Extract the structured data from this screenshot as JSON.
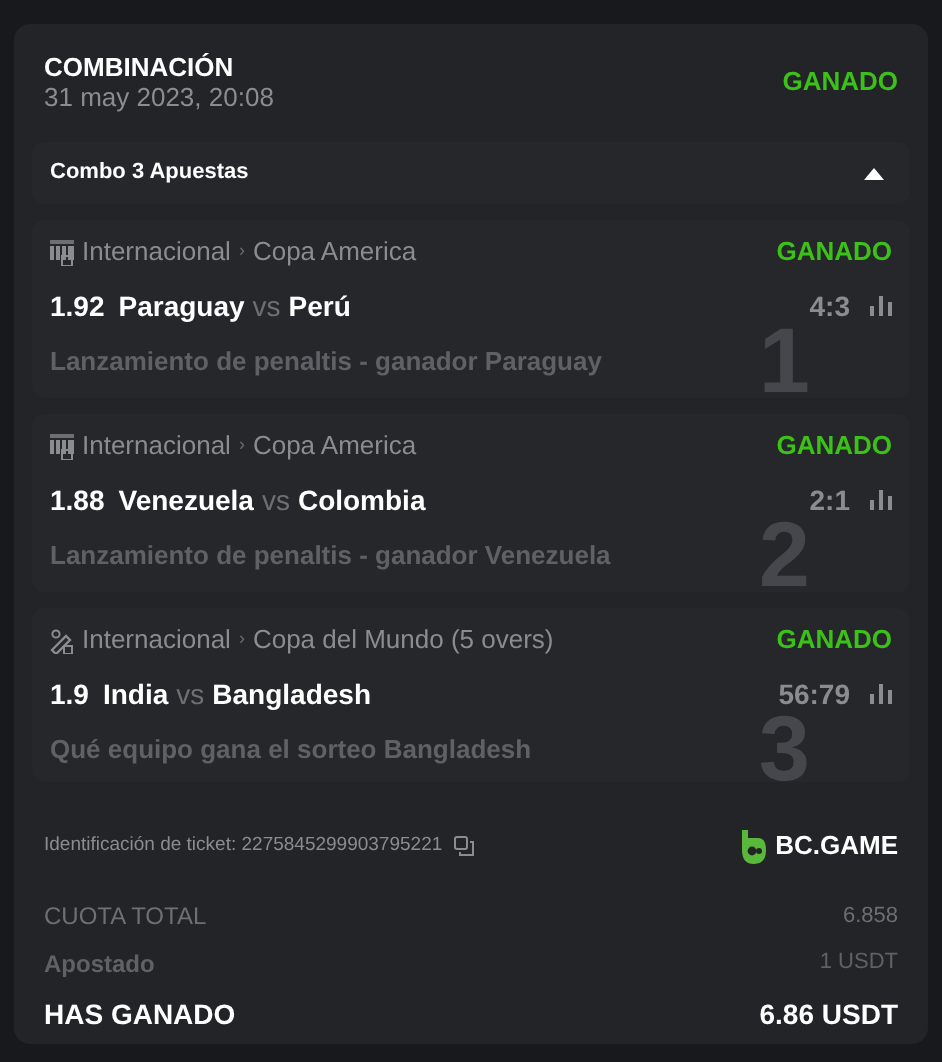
{
  "header": {
    "title": "COMBINACIÓN",
    "date": "31 may 2023, 20:08",
    "status": "GANADO"
  },
  "combo": {
    "label": "Combo 3 Apuestas",
    "expanded": true
  },
  "bets": [
    {
      "kind": "football",
      "league": "Internacional",
      "separator": "›",
      "tournament": "Copa America",
      "status": "GANADO",
      "odds": "1.92",
      "home": "Paraguay",
      "vs": "vs",
      "away": "Perú",
      "score": "4:3",
      "market": "Lanzamiento de penaltis - ganador Paraguay",
      "index": "1"
    },
    {
      "kind": "football",
      "league": "Internacional",
      "separator": "›",
      "tournament": "Copa America",
      "status": "GANADO",
      "odds": "1.88",
      "home": "Venezuela",
      "vs": "vs",
      "away": "Colombia",
      "score": "2:1",
      "market": "Lanzamiento de penaltis - ganador Venezuela",
      "index": "2"
    },
    {
      "kind": "cricket",
      "league": "Internacional",
      "separator": "›",
      "tournament": "Copa del Mundo (5 overs)",
      "status": "GANADO",
      "odds": "1.9",
      "home": "India",
      "vs": "vs",
      "away": "Bangladesh",
      "score": "56:79",
      "market": "Qué equipo gana el sorteo Bangladesh",
      "index": "3"
    }
  ],
  "ticket": {
    "label": "Identificación de ticket: 2275845299903795221",
    "brand": "BC.GAME"
  },
  "totals": [
    {
      "kind": "odds",
      "label": "CUOTA TOTAL",
      "value": "6.858"
    },
    {
      "kind": "stake",
      "label": "Apostado",
      "value": "1 USDT"
    },
    {
      "kind": "win",
      "label": "HAS GANADO",
      "value": "6.86 USDT"
    }
  ]
}
